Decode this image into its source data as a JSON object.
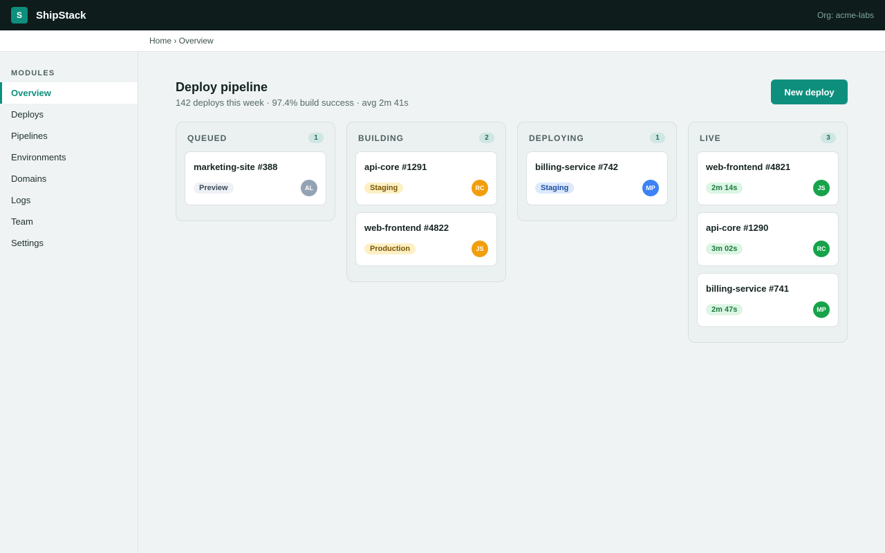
{
  "app": {
    "logo_letter": "S",
    "name": "ShipStack",
    "org": "Org: acme-labs"
  },
  "breadcrumb": "Home › Overview",
  "sidebar": {
    "heading": "MODULES",
    "items": [
      {
        "label": "Overview",
        "active": true
      },
      {
        "label": "Deploys"
      },
      {
        "label": "Pipelines"
      },
      {
        "label": "Environments"
      },
      {
        "label": "Domains"
      },
      {
        "label": "Logs"
      },
      {
        "label": "Team"
      },
      {
        "label": "Settings"
      }
    ]
  },
  "main": {
    "title": "Deploy pipeline",
    "subtitle": "142 deploys this week · 97.4% build success · avg 2m 41s",
    "new_deploy_label": "New deploy"
  },
  "colors": {
    "accent": "#0e8f7e",
    "tag_preview": {
      "bg": "#eef1f5",
      "fg": "#3f4a5a"
    },
    "tag_staging_amber": {
      "bg": "#fdf0c4",
      "fg": "#7a5506"
    },
    "tag_staging_blue": {
      "bg": "#dce9fb",
      "fg": "#1d4fa3"
    },
    "tag_production": {
      "bg": "#fdf0c4",
      "fg": "#7a5506"
    },
    "tag_live": {
      "bg": "#dcf5e4",
      "fg": "#1c7a3c"
    },
    "avatar_gray": "#94a3b3",
    "avatar_orange": "#f19e0b",
    "avatar_blue": "#3b82f6",
    "avatar_green": "#16a34a"
  },
  "columns": [
    {
      "title": "QUEUED",
      "count": "1",
      "cards": [
        {
          "title": "marketing-site #388",
          "tag": "Preview",
          "tag_style": "preview",
          "avatar": "AL",
          "avatar_color": "gray"
        }
      ]
    },
    {
      "title": "BUILDING",
      "count": "2",
      "cards": [
        {
          "title": "api-core #1291",
          "tag": "Staging",
          "tag_style": "staging_amber",
          "avatar": "RC",
          "avatar_color": "orange"
        },
        {
          "title": "web-frontend #4822",
          "tag": "Production",
          "tag_style": "production",
          "avatar": "JS",
          "avatar_color": "orange"
        }
      ]
    },
    {
      "title": "DEPLOYING",
      "count": "1",
      "cards": [
        {
          "title": "billing-service #742",
          "tag": "Staging",
          "tag_style": "staging_blue",
          "avatar": "MP",
          "avatar_color": "blue"
        }
      ]
    },
    {
      "title": "LIVE",
      "count": "3",
      "cards": [
        {
          "title": "web-frontend #4821",
          "tag": "2m 14s",
          "tag_style": "live",
          "avatar": "JS",
          "avatar_color": "green"
        },
        {
          "title": "api-core #1290",
          "tag": "3m 02s",
          "tag_style": "live",
          "avatar": "RC",
          "avatar_color": "green"
        },
        {
          "title": "billing-service #741",
          "tag": "2m 47s",
          "tag_style": "live",
          "avatar": "MP",
          "avatar_color": "green"
        }
      ]
    }
  ]
}
